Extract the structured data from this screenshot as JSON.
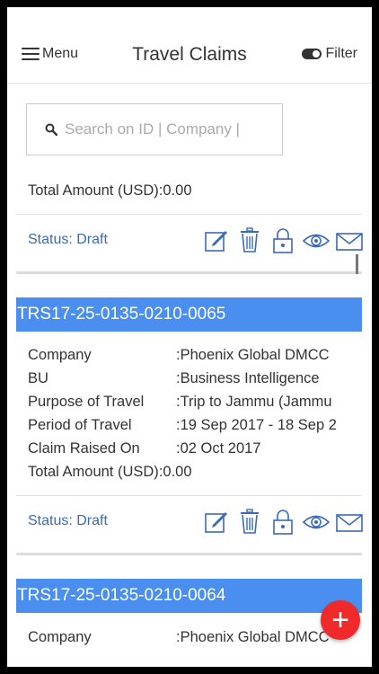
{
  "header": {
    "menu_label": "Menu",
    "title": "Travel Claims",
    "filter_label": "Filter"
  },
  "search": {
    "placeholder": "Search on ID | Company |"
  },
  "summary": {
    "total_text": "Total Amount (USD):0.00",
    "status_text": "Status: Draft"
  },
  "claims": [
    {
      "id": "TRS17-25-0135-0210-0065",
      "company_label": "Company",
      "company_value": ":Phoenix Global DMCC",
      "bu_label": "BU",
      "bu_value": ":Business Intelligence",
      "purpose_label": "Purpose of Travel",
      "purpose_value": ":Trip to Jammu (Jammu",
      "period_label": "Period of Travel",
      "period_value": ":19 Sep 2017 - 18 Sep 2",
      "raised_label": "Claim Raised On",
      "raised_value": ":02 Oct 2017",
      "total_label": "Total Amount (USD)",
      "total_value": ":0.00",
      "status": "Status: Draft"
    },
    {
      "id": "TRS17-25-0135-0210-0064",
      "company_label": "Company",
      "company_value": ":Phoenix Global DMCC"
    }
  ],
  "fab": {
    "label": "+"
  },
  "colors": {
    "accent": "#4a8ff0",
    "status": "#3a6bb5",
    "fab": "#f02a2a"
  }
}
